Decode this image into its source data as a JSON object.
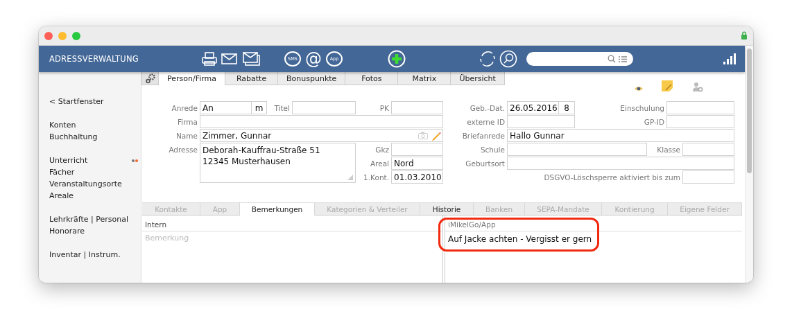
{
  "header": {
    "title": "ADRESSVERWALTUNG",
    "actions": [
      {
        "kind": "printer"
      },
      {
        "kind": "mail"
      },
      {
        "kind": "mails"
      },
      {
        "kind": "bubble",
        "label": "SMS"
      },
      {
        "kind": "glyph",
        "label": "@"
      },
      {
        "kind": "bubble",
        "label": "App"
      },
      {
        "kind": "add"
      },
      {
        "kind": "refresh"
      },
      {
        "kind": "find"
      }
    ]
  },
  "sidebar": {
    "groups": [
      {
        "items": [
          {
            "label": "< Startfenster",
            "flagged": false
          }
        ]
      },
      {
        "items": [
          {
            "label": "Konten",
            "flagged": false
          },
          {
            "label": "Buchhaltung",
            "flagged": false
          }
        ]
      },
      {
        "items": [
          {
            "label": "Unterricht",
            "flagged": true
          },
          {
            "label": "Fächer",
            "flagged": false
          },
          {
            "label": "Veranstaltungsorte",
            "flagged": false
          },
          {
            "label": "Areale",
            "flagged": false
          }
        ]
      },
      {
        "items": [
          {
            "label": "Lehrkräfte | Personal",
            "flagged": false
          },
          {
            "label": "Honorare",
            "flagged": false
          }
        ]
      },
      {
        "items": [
          {
            "label": "Inventar | Instrum.",
            "flagged": false
          }
        ]
      }
    ]
  },
  "top_tabs": [
    {
      "label": "Person/Firma",
      "selected": true
    },
    {
      "label": "Rabatte",
      "selected": false
    },
    {
      "label": "Bonuspunkte",
      "selected": false
    },
    {
      "label": "Fotos",
      "selected": false
    },
    {
      "label": "Matrix",
      "selected": false
    },
    {
      "label": "Übersicht",
      "selected": false
    }
  ],
  "form": {
    "fields": [
      {
        "kind": "line",
        "label": "Anrede",
        "value": "An",
        "suffix": "m"
      },
      {
        "kind": "line",
        "label": "Titel"
      },
      {
        "kind": "line",
        "label": "PK"
      },
      {
        "kind": "line",
        "label": "Firma"
      },
      {
        "kind": "photo",
        "label": "Name",
        "value": "Zimmer, Gunnar"
      },
      {
        "kind": "multiline",
        "label": "Adresse",
        "value": "Deborah-Kauffrau-Straße 51\n12345 Musterhausen"
      },
      {
        "kind": "line",
        "label": "Gkz"
      },
      {
        "kind": "line",
        "label": "Areal",
        "value": "Nord"
      },
      {
        "kind": "line",
        "label": "1.Kont.",
        "value": "01.03.2010"
      },
      {
        "kind": "line",
        "label": "Geb.-Dat.",
        "value": "26.05.2016",
        "suffix": "8"
      },
      {
        "kind": "line",
        "label": "Einschulung"
      },
      {
        "kind": "line",
        "label": "externe ID"
      },
      {
        "kind": "line",
        "label": "GP-ID"
      },
      {
        "kind": "line",
        "label": "Briefanrede",
        "value": "Hallo Gunnar"
      },
      {
        "kind": "line",
        "label": "Schule"
      },
      {
        "kind": "line",
        "label": "Klasse"
      },
      {
        "kind": "line",
        "label": "Geburtsort"
      },
      {
        "kind": "line",
        "label": "DSGVO-Löschsperre aktiviert bis zum"
      }
    ]
  },
  "detail_tabs": [
    {
      "label": "Kontakte",
      "selected": false,
      "disabled": true
    },
    {
      "label": "App",
      "selected": false,
      "disabled": true
    },
    {
      "label": "Bemerkungen",
      "selected": true,
      "disabled": false
    },
    {
      "label": "Kategorien & Verteiler",
      "selected": false,
      "disabled": true
    },
    {
      "label": "Historie",
      "selected": false,
      "disabled": false
    },
    {
      "label": "Banken",
      "selected": false,
      "disabled": true
    },
    {
      "label": "SEPA-Mandate",
      "selected": false,
      "disabled": true
    },
    {
      "label": "Kontierung",
      "selected": false,
      "disabled": true
    },
    {
      "label": "Eigene Felder",
      "selected": false,
      "disabled": true
    }
  ],
  "notes": {
    "intern": {
      "title": "Intern",
      "placeholder": "Bemerkung"
    },
    "app": {
      "title": "iMikelGo/App",
      "value": "Auf Jacke achten - Vergisst er gern",
      "highlighted": true
    }
  }
}
